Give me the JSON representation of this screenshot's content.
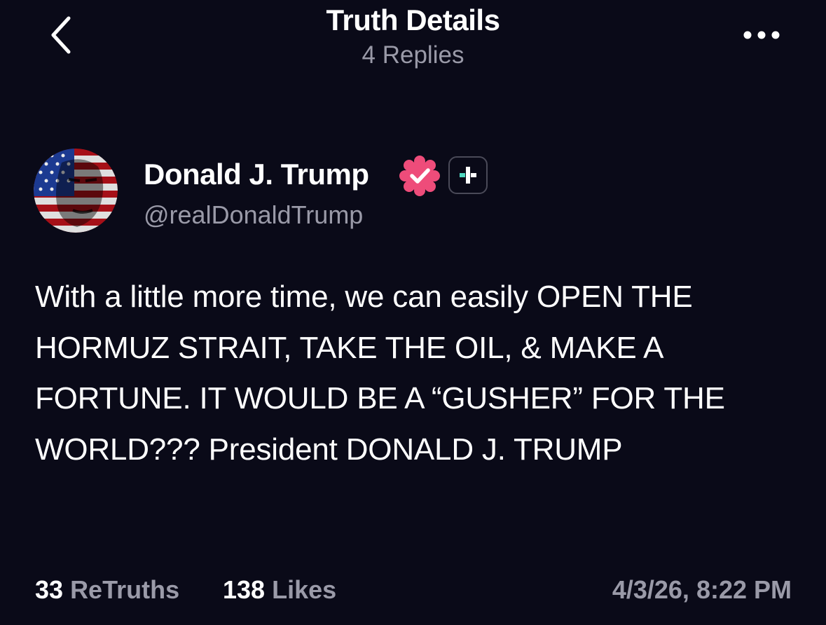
{
  "header": {
    "title": "Truth Details",
    "subtitle": "4 Replies",
    "back_icon": "chevron-left-icon",
    "more_icon": "ellipsis-icon"
  },
  "author": {
    "name": "Donald J. Trump",
    "handle": "@realDonaldTrump",
    "verified_icon": "verified-badge-icon",
    "verified_color": "#ee4c7a",
    "plus_icon": "plus-badge-icon",
    "plus_color": "#4fd8c0"
  },
  "post": {
    "text": "With a little more time, we can easily OPEN THE HORMUZ STRAIT, TAKE THE OIL, & MAKE A FORTUNE. IT WOULD BE A “GUSHER” FOR THE WORLD??? President DONALD J. TRUMP"
  },
  "stats": {
    "retruths_count": "33",
    "retruths_label": "ReTruths",
    "likes_count": "138",
    "likes_label": "Likes",
    "timestamp": "4/3/26, 8:22 PM"
  },
  "colors": {
    "background": "#0a0a18",
    "text_primary": "#ffffff",
    "text_secondary": "#9a9aa8"
  }
}
